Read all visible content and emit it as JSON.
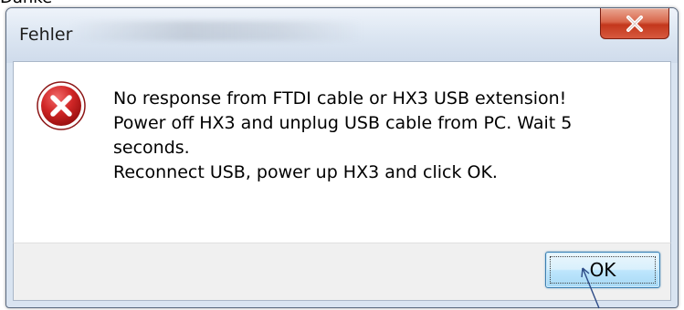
{
  "top_fragment": "Danke",
  "dialog": {
    "title": "Fehler",
    "close_icon": "close-icon",
    "error_icon": "error-icon",
    "message_lines": [
      "No response from FTDI cable or HX3 USB extension!",
      "Power off HX3 and unplug USB cable from PC. Wait 5",
      "seconds.",
      "Reconnect USB, power up HX3 and click OK."
    ],
    "ok_label": "OK"
  },
  "colors": {
    "close_button": "#c7442a",
    "error_circle": "#c41d1d",
    "ok_button_border": "#3c7fb1",
    "annotation_arrow": "#2c4a86"
  }
}
